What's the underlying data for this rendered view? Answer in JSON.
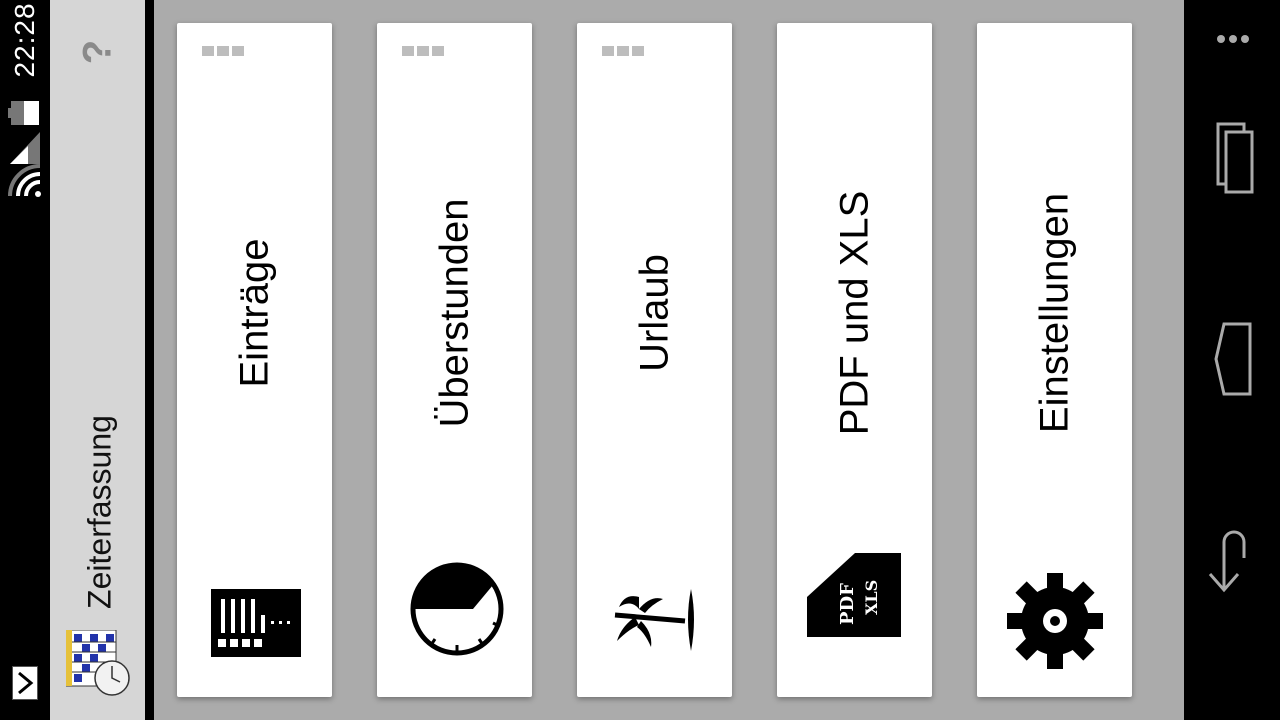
{
  "status_bar": {
    "time": "22:28"
  },
  "app": {
    "title": "Zeiterfassung",
    "help_glyph": "?"
  },
  "cards": [
    {
      "label": "Einträge",
      "icon": "entries-grid-icon"
    },
    {
      "label": "Überstunden",
      "icon": "overtime-clock-icon"
    },
    {
      "label": "Urlaub",
      "icon": "palm-tree-icon"
    },
    {
      "label": "PDF und XLS",
      "icon": "pdf-xls-icon",
      "icon_text": {
        "pdf": "PDF",
        "xls": "XLS"
      }
    },
    {
      "label": "Einstellungen",
      "icon": "gear-icon"
    }
  ],
  "colors": {
    "background": "#ababab",
    "card": "#ffffff",
    "title_strip": "#d6d6d6",
    "system_bars": "#000000"
  }
}
